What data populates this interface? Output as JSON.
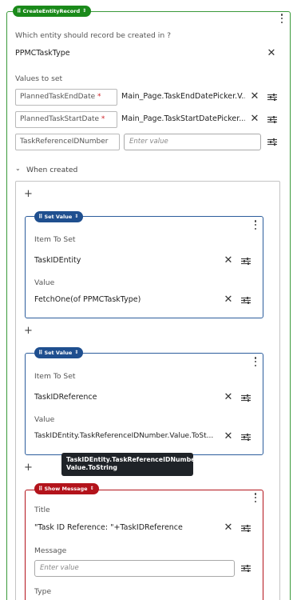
{
  "colors": {
    "green": "#1a8a1a",
    "navy": "#1f4f8f",
    "red": "#b3131b"
  },
  "create": {
    "pill": "CreateEntityRecord",
    "question": "Which entity should record be created in ?",
    "entity": "PPMCTaskType",
    "values_heading": "Values to set",
    "rows": [
      {
        "name": "PlannedTaskEndDate",
        "required": "*",
        "value": "Main_Page.TaskEndDatePicker.V..."
      },
      {
        "name": "PlannedTaskStartDate",
        "required": "*",
        "value": "Main_Page.TaskStartDatePicker...."
      },
      {
        "name": "TaskReferenceIDNumber",
        "placeholder": "Enter value"
      }
    ],
    "when_created": "When created"
  },
  "set1": {
    "pill": "Set Value",
    "item_label": "Item To Set",
    "item_value": "TaskIDEntity",
    "value_label": "Value",
    "value_value": "FetchOne(of PPMCTaskType)"
  },
  "set2": {
    "pill": "Set Value",
    "item_label": "Item To Set",
    "item_value": "TaskIDReference",
    "value_label": "Value",
    "value_value": "TaskIDEntity.TaskReferenceIDNumber.Value.ToSt..."
  },
  "tooltip": {
    "line1": "TaskIDEntity.TaskReferenceIDNumber.",
    "line2": "Value.ToString"
  },
  "show": {
    "pill": "Show Message",
    "title_label": "Title",
    "title_value": "\"Task ID Reference: \"+TaskIDReference",
    "message_label": "Message",
    "message_placeholder": "Enter value",
    "type_label": "Type"
  }
}
